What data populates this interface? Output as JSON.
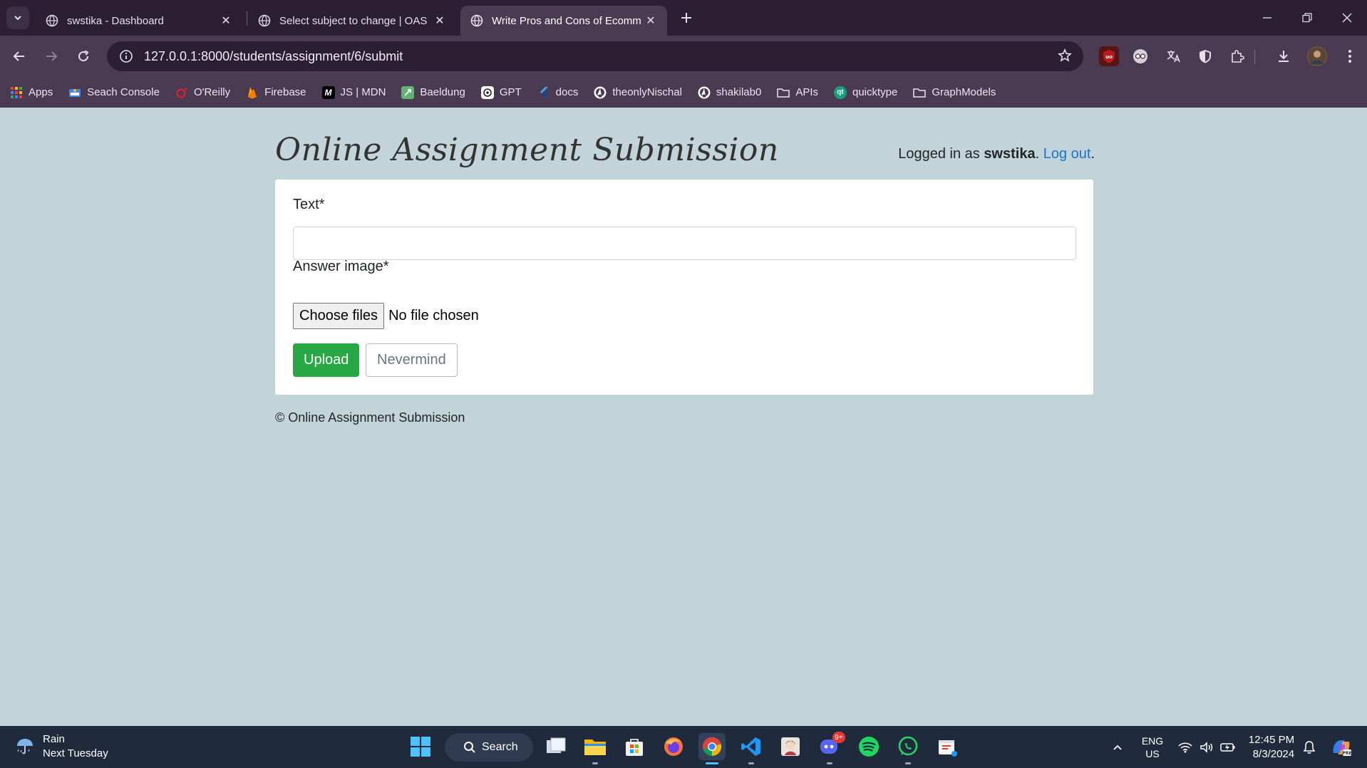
{
  "browser": {
    "tabs": [
      {
        "title": "swstika - Dashboard",
        "active": false
      },
      {
        "title": "Select subject to change | OAS",
        "active": false
      },
      {
        "title": "Write Pros and Cons of Ecomm",
        "active": true
      }
    ],
    "url": "127.0.0.1:8000/students/assignment/6/submit",
    "bookmarks": [
      {
        "label": "Apps"
      },
      {
        "label": "Seach Console"
      },
      {
        "label": "O'Reilly"
      },
      {
        "label": "Firebase"
      },
      {
        "label": "JS | MDN"
      },
      {
        "label": "Baeldung"
      },
      {
        "label": "GPT"
      },
      {
        "label": "docs"
      },
      {
        "label": "theonlyNischal"
      },
      {
        "label": "shakilab0"
      },
      {
        "label": "APIs"
      },
      {
        "label": "quicktype"
      },
      {
        "label": "GraphModels"
      }
    ]
  },
  "page": {
    "brand": "Online Assignment Submission",
    "login": {
      "prefix": "Logged in as ",
      "username": "swstika",
      "separator": ". ",
      "logout_label": "Log out",
      "suffix": "."
    },
    "form": {
      "text_label": "Text*",
      "text_value": "",
      "image_label": "Answer image*",
      "file_button_label": "Choose files",
      "file_status": "No file chosen",
      "upload_label": "Upload",
      "cancel_label": "Nevermind"
    },
    "footer": "© Online Assignment Submission"
  },
  "taskbar": {
    "weather": {
      "condition": "Rain",
      "forecast": "Next Tuesday"
    },
    "search_label": "Search",
    "discord_badge": "9+",
    "lang_top": "ENG",
    "lang_bottom": "US",
    "time": "12:45 PM",
    "date": "8/3/2024"
  },
  "colors": {
    "page_bg": "#c2d4d9",
    "upload_green": "#28a745",
    "link_blue": "#1a73c9",
    "chrome_frame": "#2c1f33",
    "chrome_toolbar": "#4a3a52"
  }
}
